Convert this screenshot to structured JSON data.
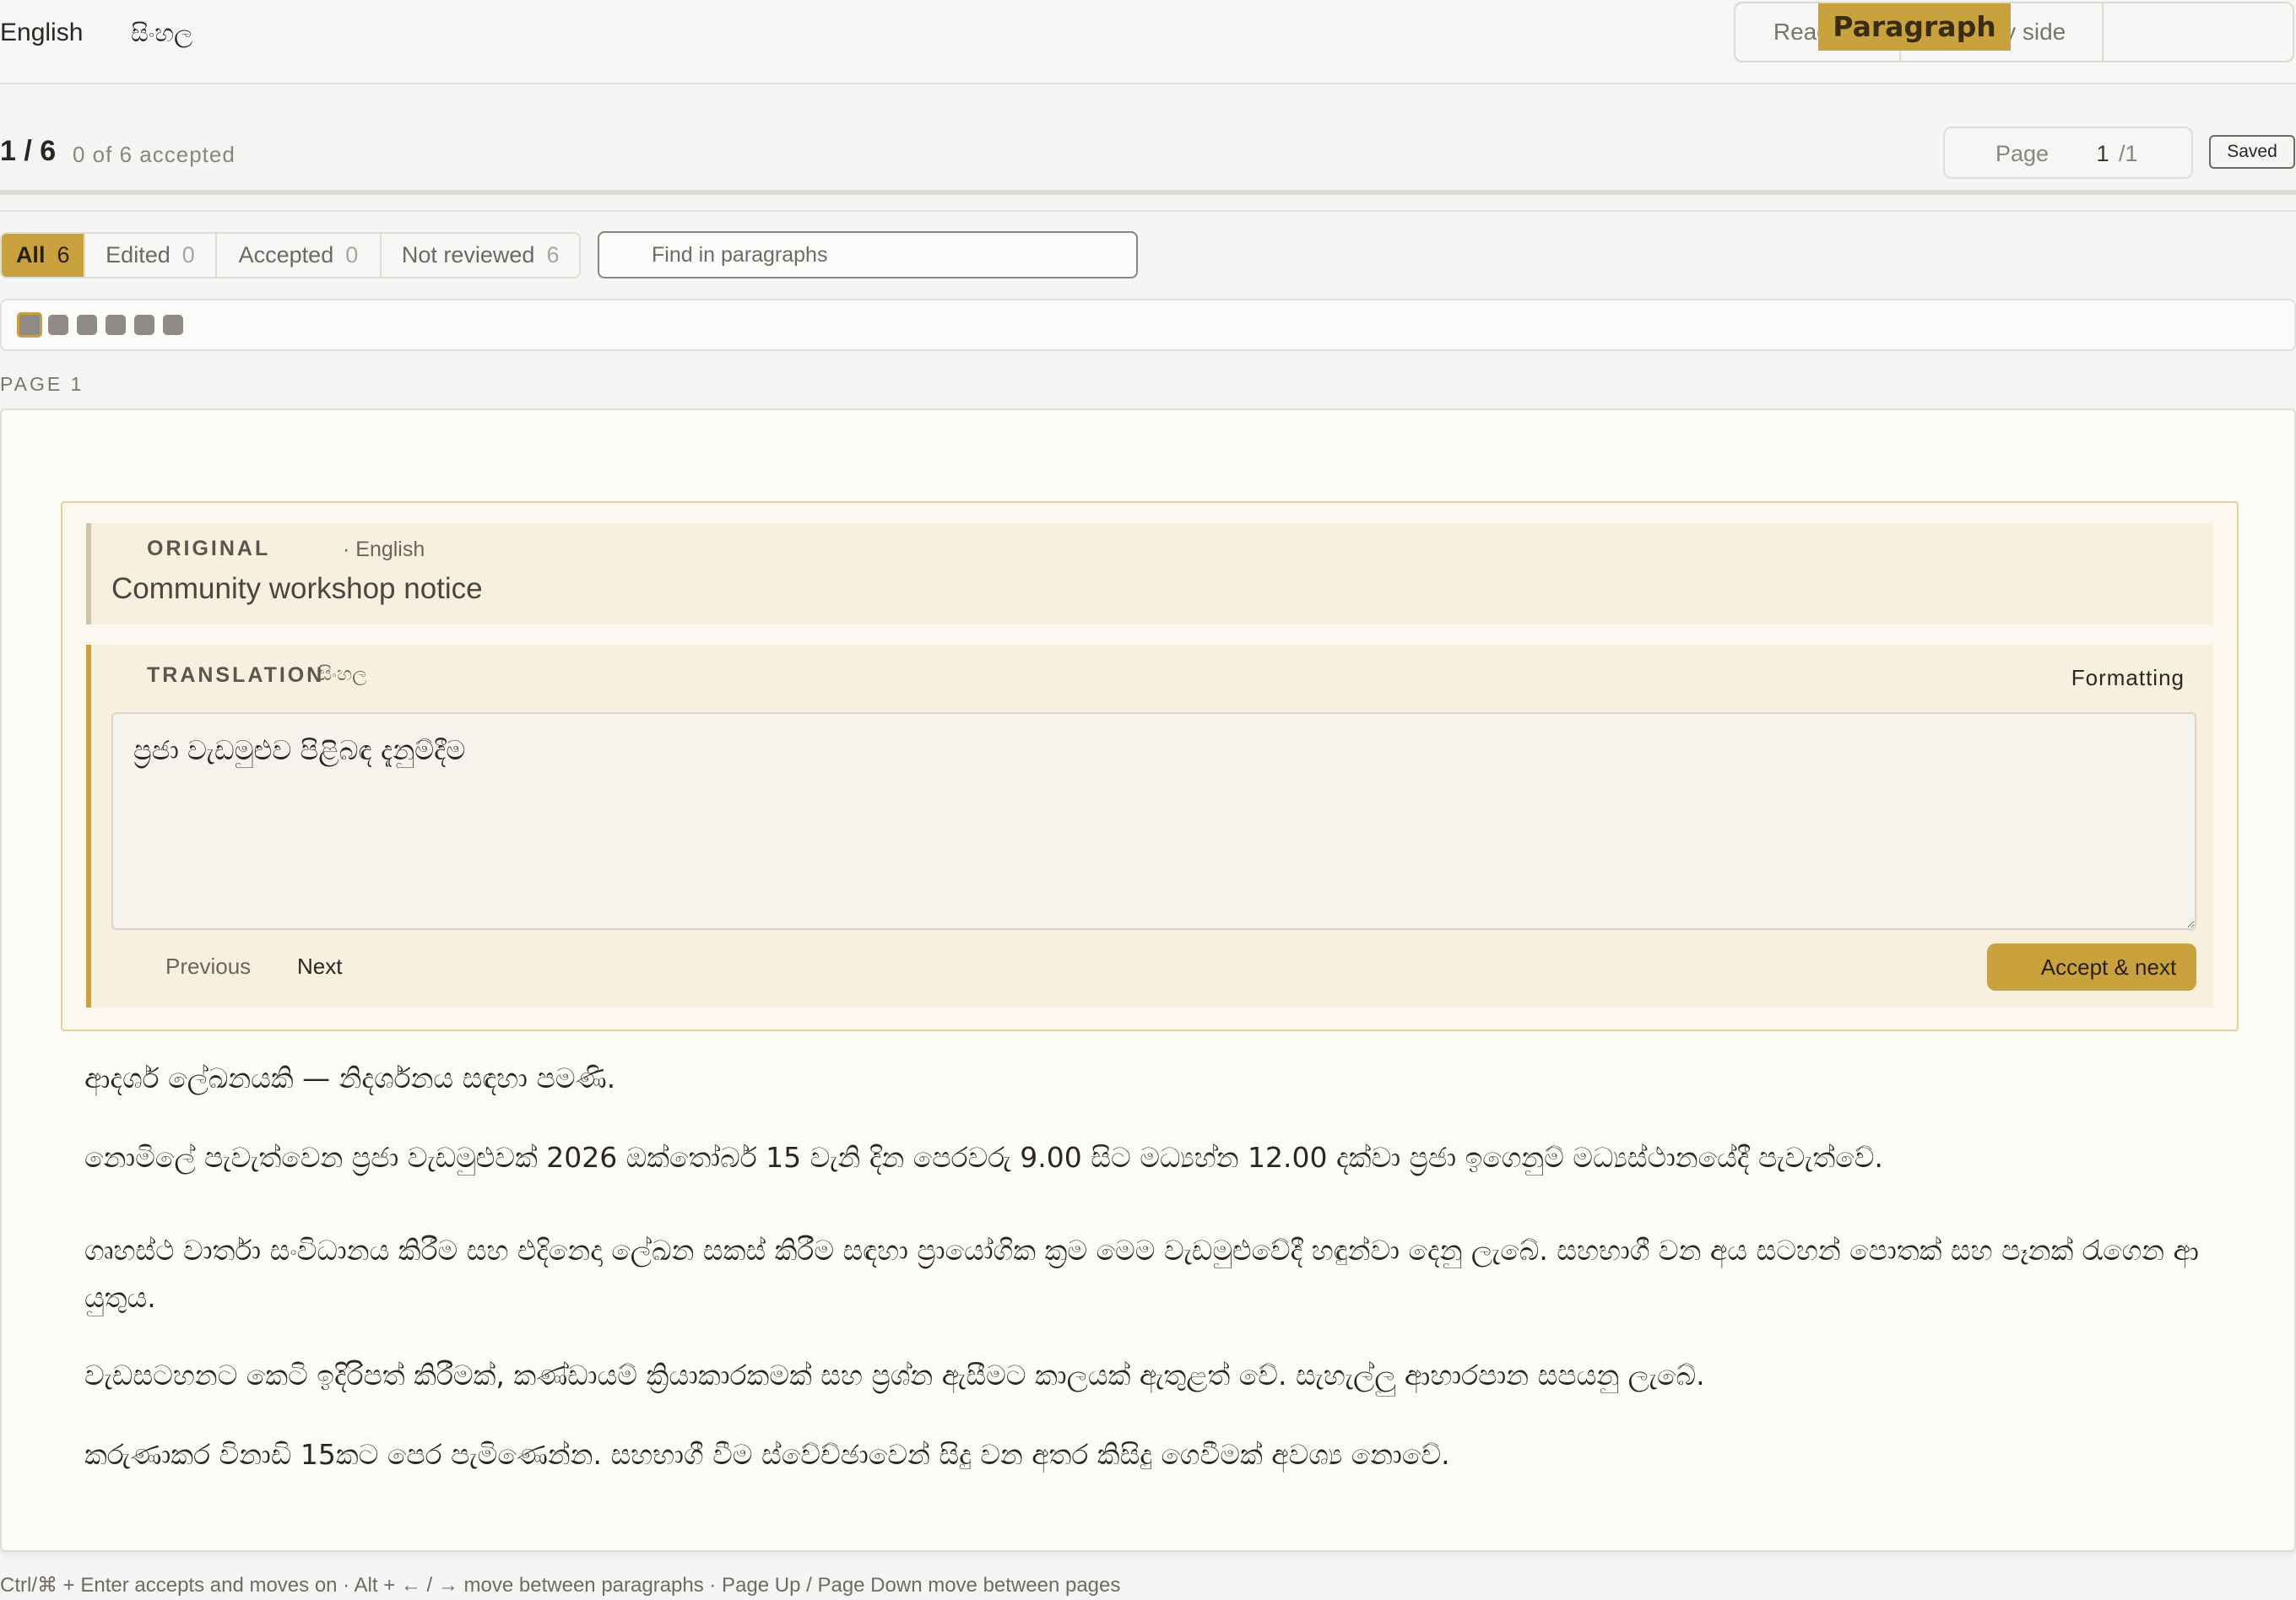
{
  "languages": {
    "source": "English",
    "target": "සිංහල"
  },
  "view_modes": {
    "reading": "Reading",
    "side_by_side": "Side by side",
    "paragraph": "Paragraph",
    "active": "Paragraph"
  },
  "status": {
    "counter": "1 / 6",
    "accepted_text": "0 of 6 accepted",
    "progress_fraction": 0.0
  },
  "pager": {
    "label": "Page",
    "current": "1",
    "total": "/1"
  },
  "save_state": "Saved",
  "filters": {
    "all": {
      "label": "All",
      "count": "6"
    },
    "edited": {
      "label": "Edited",
      "count": "0"
    },
    "accepted": {
      "label": "Accepted",
      "count": "0"
    },
    "not_reviewed": {
      "label": "Not reviewed",
      "count": "6"
    },
    "active": "All"
  },
  "search": {
    "placeholder": "Find in paragraphs",
    "value": ""
  },
  "paragraph_strip": {
    "count": 6,
    "current_index": 0
  },
  "page_label": "PAGE 1",
  "editor": {
    "original_label": "ORIGINAL",
    "original_lang": "· English",
    "original_text": "Community workshop notice",
    "translation_label": "TRANSLATION",
    "translation_lang": "· සිංහල",
    "formatting": "Formatting",
    "translation_value": "ප්‍රජා වැඩමුළුව පිළිබඳ දැනුම්දීම",
    "previous": "Previous",
    "next": "Next",
    "accept_next": "Accept & next"
  },
  "paragraphs": [
    "ආදර්ශ ලේඛනයකි — නිදර්ශනය සඳහා පමණි.",
    "නොමිලේ පැවැත්වෙන ප්‍රජා වැඩමුළුවක් 2026 ඔක්තෝබර් 15 වැනි දින පෙරවරු 9.00 සිට මධ්‍යහ්න 12.00 දක්වා ප්‍රජා ඉගෙනුම් මධ්‍යස්ථානයේදී පැවැත්වේ.",
    "ගෘහස්ථ වාර්තා සංවිධානය කිරීම සහ එදිනෙදා ලේඛන සකස් කිරීම සඳහා ප්‍රායෝගික ක්‍රම මෙම වැඩමුළුවේදී හඳුන්වා දෙනු ලැබේ. සහභාගී වන අය සටහන් පොතක් සහ පෑනක් රැගෙන ආ යුතුය.",
    "වැඩසටහනට කෙටි ඉදිරිපත් කිරීමක්, කණ්ඩායම් ක්‍රියාකාරකමක් සහ ප්‍රශ්න ඇසීමට කාලයක් ඇතුළත් වේ. සැහැල්ලු ආහාරපාන සපයනු ලැබේ.",
    "කරුණාකර විනාඩි 15කට පෙර පැමිණෙන්න. සහභාගී වීම ස්වේච්ඡාවෙන් සිදු වන අතර කිසිදු ගෙවීමක් අවශ්‍ය නොවේ."
  ],
  "footer_hint": "Ctrl/⌘ + Enter accepts and moves on · Alt + ← / → move between paragraphs · Page Up / Page Down move between pages",
  "colors": {
    "accent": "#c9a23e",
    "page_bg": "#fdfcf7",
    "editor_bg": "#f8efdf"
  }
}
